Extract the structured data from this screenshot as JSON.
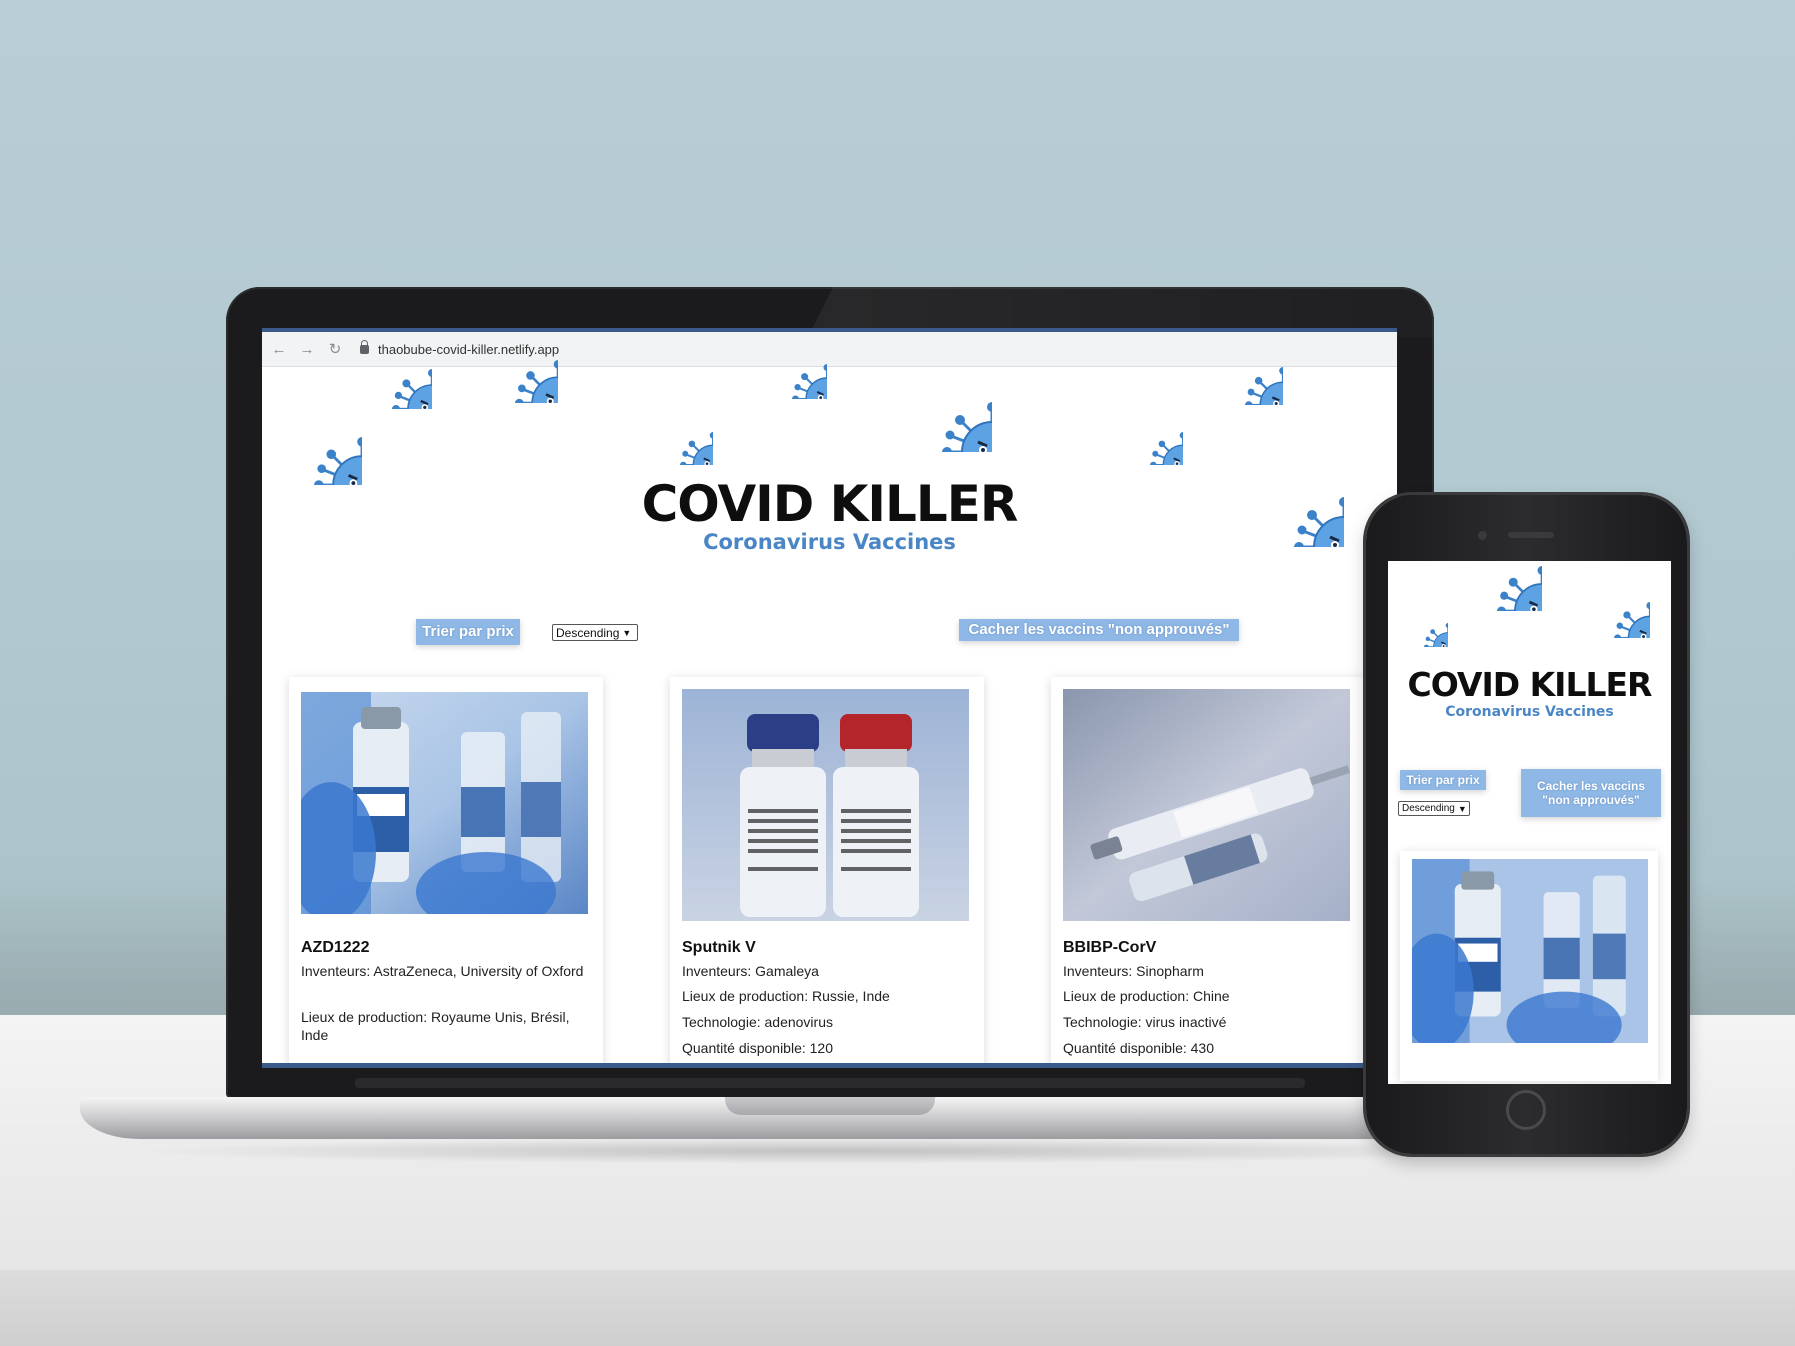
{
  "browser": {
    "url": "thaobube-covid-killer.netlify.app"
  },
  "header": {
    "title": "COVID KILLER",
    "subtitle": "Coronavirus Vaccines"
  },
  "controls": {
    "sort_button": "Trier par prix",
    "sort_select": "Descending",
    "hide_button": "Cacher les vaccins \"non approuvés\"",
    "hide_button_mobile_line1": "Cacher les vaccins",
    "hide_button_mobile_line2": "\"non approuvés\""
  },
  "vaccines": [
    {
      "name": "AZD1222",
      "inventors": "Inventeurs: AstraZeneca, University of Oxford",
      "production": "Lieux de production: Royaume Unis, Brésil, Inde"
    },
    {
      "name": "Sputnik V",
      "inventors": "Inventeurs: Gamaleya",
      "production": "Lieux de production: Russie, Inde",
      "technology": "Technologie: adenovirus",
      "quantity": "Quantité disponible: 120"
    },
    {
      "name": "BBIBP-CorV",
      "inventors": "Inventeurs: Sinopharm",
      "production": "Lieux de production: Chine",
      "technology": "Technologie: virus inactivé",
      "quantity": "Quantité disponible: 430"
    }
  ],
  "colors": {
    "accent": "#8fb8e6",
    "subtitle": "#4a86c5",
    "frame_bar": "#3a5a8c"
  }
}
